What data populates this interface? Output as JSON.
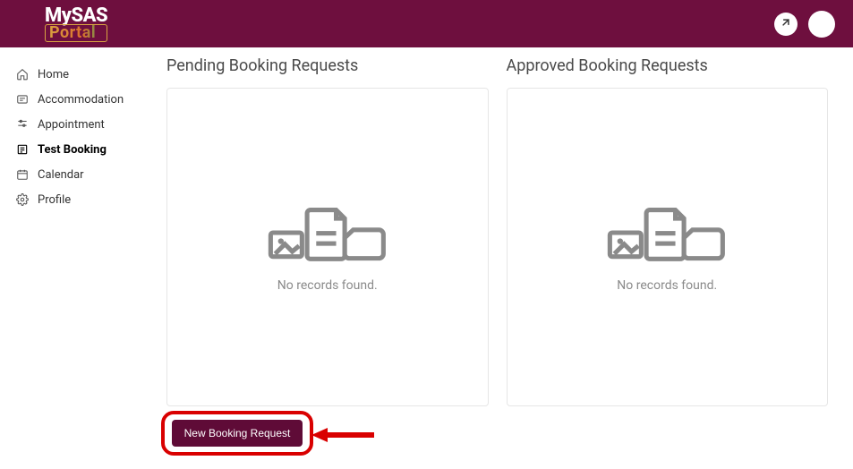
{
  "logo": {
    "top": "MySAS",
    "bottom": "Portal"
  },
  "sidebar": {
    "items": [
      {
        "label": "Home"
      },
      {
        "label": "Accommodation"
      },
      {
        "label": "Appointment"
      },
      {
        "label": "Test Booking"
      },
      {
        "label": "Calendar"
      },
      {
        "label": "Profile"
      }
    ]
  },
  "panels": {
    "pending": {
      "title": "Pending Booking Requests",
      "empty_text": "No records found.",
      "records": []
    },
    "approved": {
      "title": "Approved Booking Requests",
      "empty_text": "No records found.",
      "records": []
    }
  },
  "actions": {
    "new_booking_label": "New Booking Request"
  }
}
